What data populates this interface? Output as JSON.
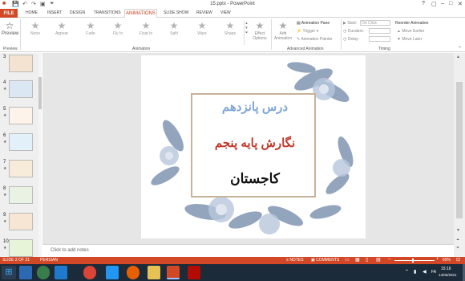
{
  "window": {
    "title": "15.pptx - PowerPoint"
  },
  "titlebar": {
    "help": "?",
    "restore": "▢",
    "minimize": "–",
    "maximize": "□",
    "close": "✕"
  },
  "tabs": [
    "FILE",
    "HOME",
    "INSERT",
    "DESIGN",
    "TRANSITIONS",
    "ANIMATIONS",
    "SLIDE SHOW",
    "REVIEW",
    "VIEW"
  ],
  "ribbon": {
    "preview_label": "Preview",
    "preview_group": "Preview",
    "effects": [
      "None",
      "Appear",
      "Fade",
      "Fly In",
      "Float In",
      "Split",
      "Wipe",
      "Shape"
    ],
    "effect_options": "Effect Options",
    "animation_group": "Animation",
    "add_animation": "Add Animation",
    "animation_pane": "Animation Pane",
    "trigger": "Trigger",
    "animation_painter": "Animation Painter",
    "advanced_group": "Advanced Animation",
    "start_label": "Start:",
    "start_value": "On Click",
    "duration_label": "Duration:",
    "delay_label": "Delay:",
    "reorder_label": "Reorder Animation",
    "move_earlier": "Move Earlier",
    "move_later": "Move Later",
    "timing_group": "Timing"
  },
  "slides_panel": [
    {
      "num": "3"
    },
    {
      "num": "4"
    },
    {
      "num": "5"
    },
    {
      "num": "6"
    },
    {
      "num": "7"
    },
    {
      "num": "8"
    },
    {
      "num": "9"
    },
    {
      "num": "10"
    }
  ],
  "slide": {
    "line1": "درس پانزدهم",
    "line2": "نگارش پایه پنجم",
    "line3": "کاجستان",
    "line1_color": "#7fa6d6",
    "line2_color": "#c0392b",
    "line3_color": "#111111"
  },
  "notes_placeholder": "Click to add notes",
  "status": {
    "slide_info": "SLIDE 2 OF 21",
    "language": "PERSIAN",
    "notes": "NOTES",
    "comments": "COMMENTS",
    "zoom": "69%"
  },
  "taskbar": {
    "lang": "FA",
    "time": "15:16",
    "date": "14/05/2021"
  }
}
